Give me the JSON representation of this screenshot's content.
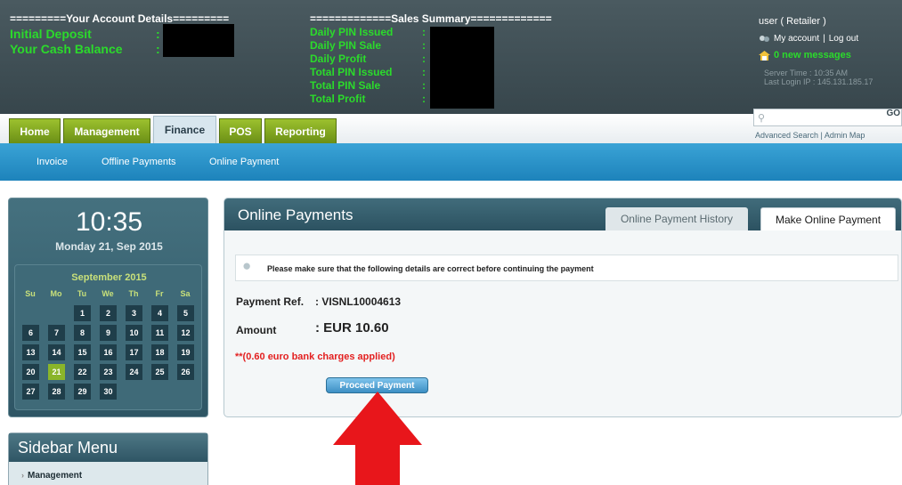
{
  "header": {
    "account_title": "=========Your Account Details=========",
    "initial_deposit": "Initial Deposit",
    "cash_balance": "Your Cash Balance",
    "colon": ":",
    "sales_title": "=============Sales Summary=============",
    "sales_labels": [
      "Daily PIN Issued",
      "Daily PIN Sale",
      "Daily Profit",
      "Total PIN Issued",
      "Total PIN Sale",
      "Total Profit"
    ]
  },
  "user_panel": {
    "user_line": "user ( Retailer )",
    "my_account": "My account",
    "separator": "|",
    "logout": "Log out",
    "messages": "0 new messages",
    "server_time": "Server Time : 10:35 AM",
    "last_login": "Last Login IP : 145.131.185.17"
  },
  "search": {
    "go": "GO",
    "links": "Advanced Search  |  Admin Map"
  },
  "tabs": [
    "Home",
    "Management",
    "Finance",
    "POS",
    "Reporting"
  ],
  "active_tab": "Finance",
  "subnav": [
    "Invoice",
    "Offline Payments",
    "Online Payment"
  ],
  "clock": {
    "time": "10:35",
    "date": "Monday 21, Sep 2015",
    "month": "September 2015",
    "weekdays": [
      "Su",
      "Mo",
      "Tu",
      "We",
      "Th",
      "Fr",
      "Sa"
    ],
    "weeks": [
      [
        "",
        "",
        "1",
        "2",
        "3",
        "4",
        "5"
      ],
      [
        "6",
        "7",
        "8",
        "9",
        "10",
        "11",
        "12"
      ],
      [
        "13",
        "14",
        "15",
        "16",
        "17",
        "18",
        "19"
      ],
      [
        "20",
        "21",
        "22",
        "23",
        "24",
        "25",
        "26"
      ],
      [
        "27",
        "28",
        "29",
        "30",
        "",
        "",
        ""
      ]
    ],
    "today": "21"
  },
  "sidebar": {
    "title": "Sidebar Menu",
    "items": [
      "Management"
    ]
  },
  "panel": {
    "title": "Online Payments",
    "tab_history": "Online Payment History",
    "tab_make": "Make Online Payment",
    "notice": "Please make sure that the following details are correct before continuing the payment",
    "payment_ref_label": "Payment Ref.",
    "payment_ref_value": ": VISNL10004613",
    "amount_label": "Amount",
    "amount_value": ": EUR 10.60",
    "charges": "**(0.60 euro bank charges applied)",
    "proceed_button": "Proceed Payment"
  },
  "colors": {
    "header_bg": "#3f4f55",
    "green_label": "#2bdb2b",
    "tab_green": "#8db52a",
    "subnav_blue": "#2a93c8",
    "arrow_red": "#e8161b",
    "charges_red": "#e32020"
  }
}
